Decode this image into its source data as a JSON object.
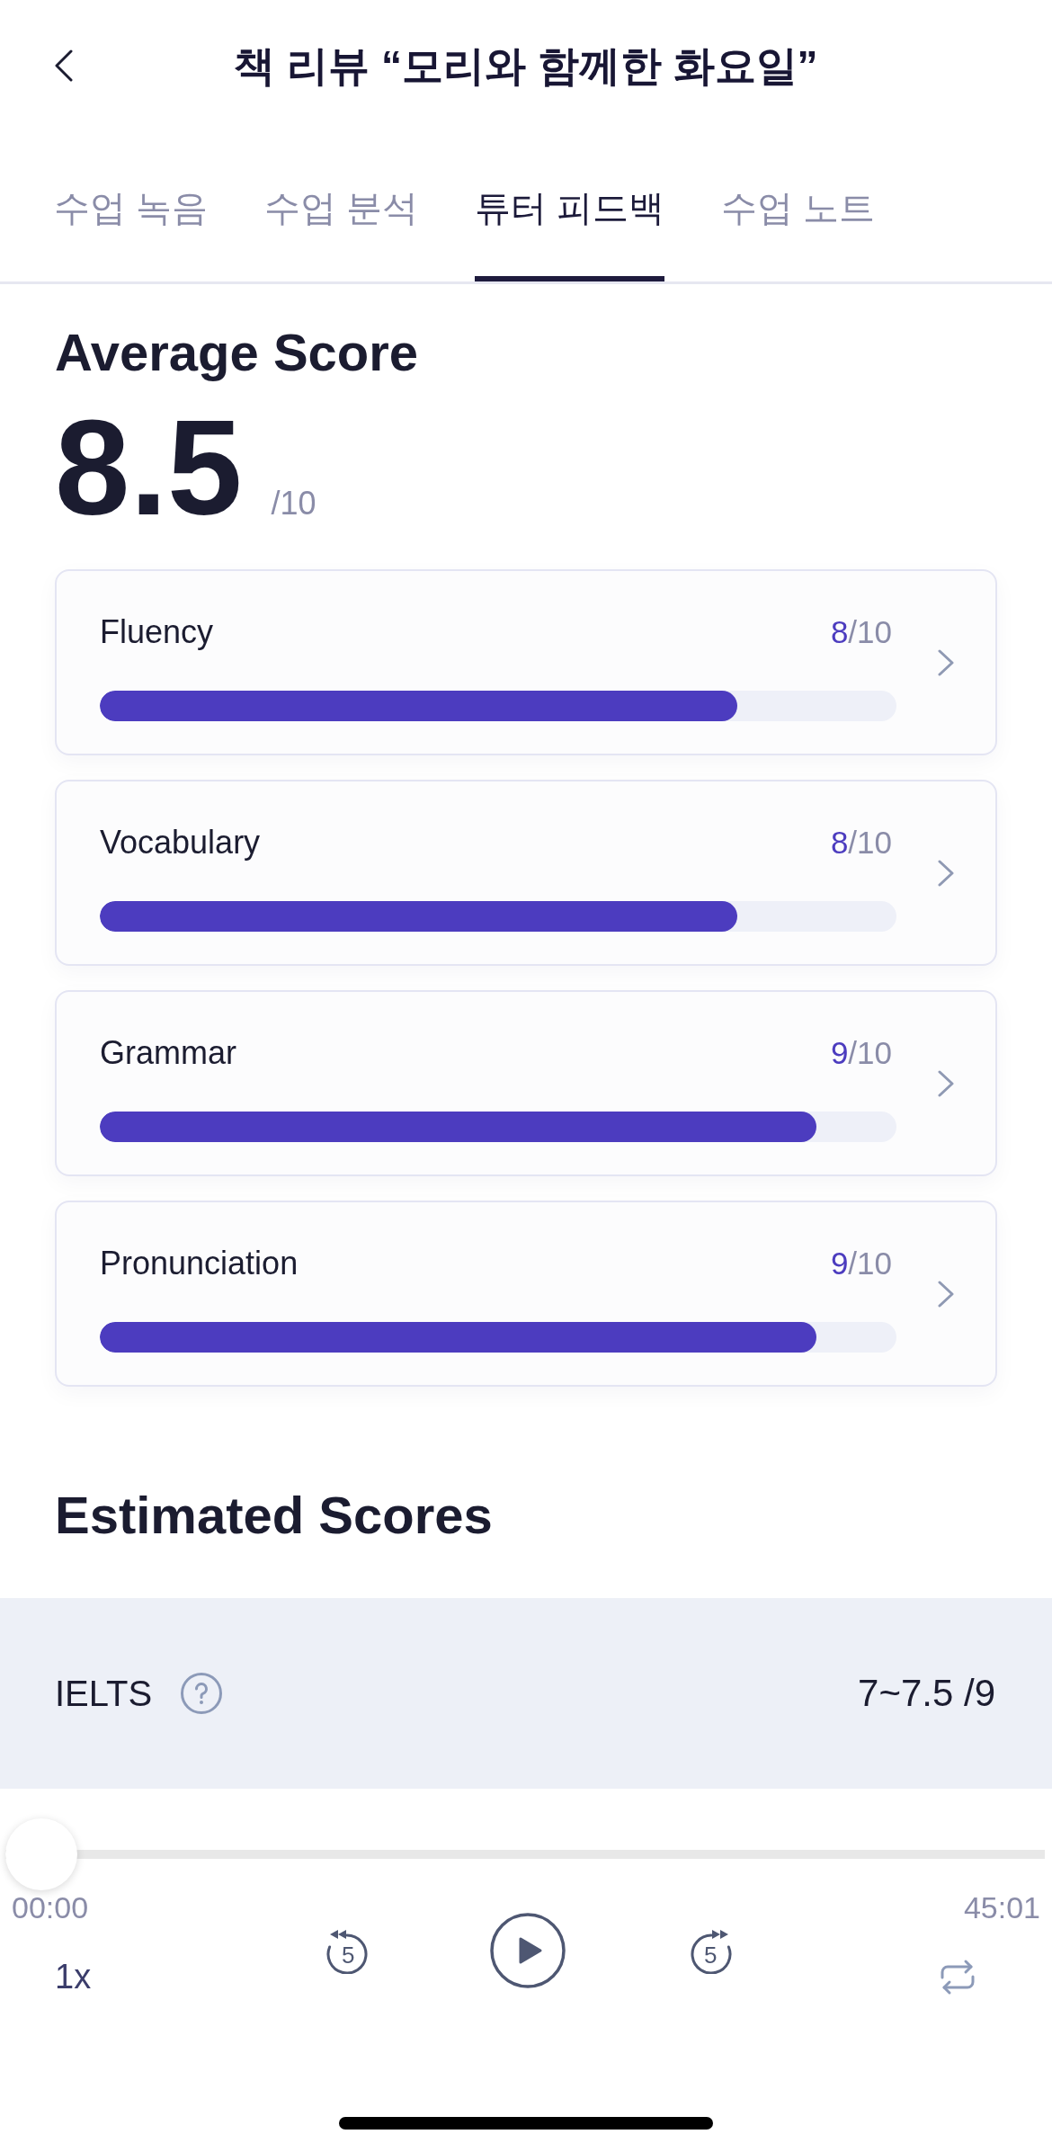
{
  "header": {
    "title": "책 리뷰 “모리와 함께한 화요일”"
  },
  "tabs": [
    {
      "label": "수업 녹음",
      "selected": false
    },
    {
      "label": "수업 분석",
      "selected": false
    },
    {
      "label": "튜터 피드백",
      "selected": true
    },
    {
      "label": "수업 노트",
      "selected": false
    }
  ],
  "average_score": {
    "heading": "Average Score",
    "value": "8.5",
    "max": "/10"
  },
  "criteria": [
    {
      "name": "Fluency",
      "score": "8",
      "max": "/10",
      "level": 0.8
    },
    {
      "name": "Vocabulary",
      "score": "8",
      "max": "/10",
      "level": 0.8
    },
    {
      "name": "Grammar",
      "score": "9",
      "max": "/10",
      "level": 0.9
    },
    {
      "name": "Pronunciation",
      "score": "9",
      "max": "/10",
      "level": 0.9
    }
  ],
  "estimated_scores": {
    "heading": "Estimated Scores",
    "rows": [
      {
        "test": "IELTS",
        "score": "7~7.5 /9"
      }
    ]
  },
  "player": {
    "seek": {
      "level": 0
    },
    "elapsed": "00:00",
    "duration": "45:01",
    "speed": "1x",
    "skip_back": "5",
    "skip_forward": "5"
  }
}
